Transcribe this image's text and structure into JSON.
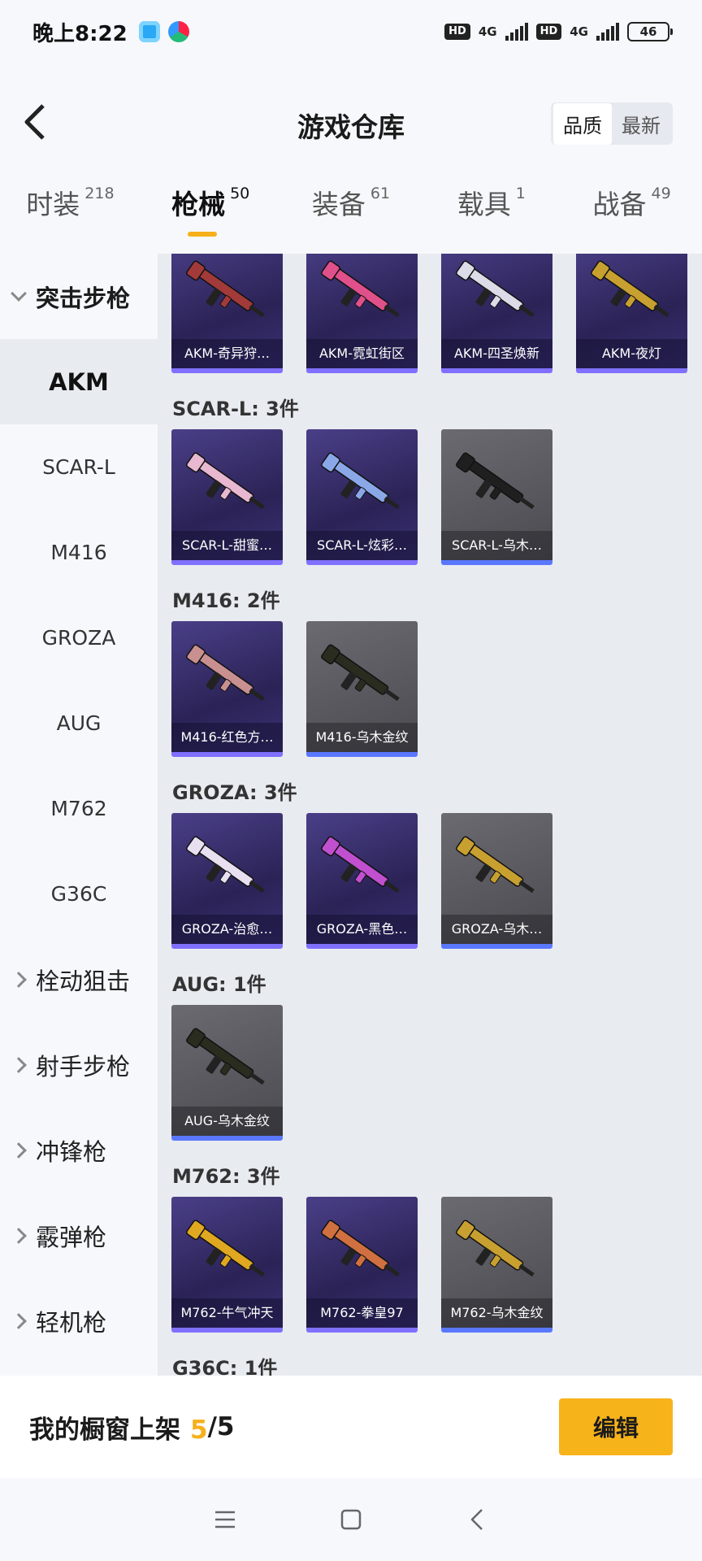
{
  "status_bar": {
    "time": "晚上8:22",
    "network_1": "4G",
    "network_2": "4G",
    "hd": "HD",
    "battery": "46"
  },
  "header": {
    "title": "游戏仓库",
    "sort_options": [
      "品质",
      "最新"
    ],
    "sort_selected": "品质"
  },
  "tabs": [
    {
      "label": "时装",
      "count": "218"
    },
    {
      "label": "枪械",
      "count": "50",
      "active": true
    },
    {
      "label": "装备",
      "count": "61"
    },
    {
      "label": "载具",
      "count": "1"
    },
    {
      "label": "战备",
      "count": "49"
    }
  ],
  "sidebar": {
    "groups": [
      {
        "label": "突击步枪",
        "expanded": true
      },
      {
        "label": "栓动狙击"
      },
      {
        "label": "射手步枪"
      },
      {
        "label": "冲锋枪"
      },
      {
        "label": "霰弹枪"
      },
      {
        "label": "轻机枪"
      }
    ],
    "items": [
      "AKM",
      "SCAR-L",
      "M416",
      "GROZA",
      "AUG",
      "M762",
      "G36C"
    ],
    "selected": "AKM"
  },
  "sections": [
    {
      "title": "",
      "cards": [
        {
          "name": "AKM-奇异狩…",
          "style": "purple",
          "color": "#a23a3a"
        },
        {
          "name": "AKM-霓虹街区",
          "style": "purple",
          "color": "#e0508a"
        },
        {
          "name": "AKM-四圣焕新",
          "style": "purple",
          "color": "#dcdce8"
        },
        {
          "name": "AKM-夜灯",
          "style": "purple",
          "color": "#c8a030"
        }
      ]
    },
    {
      "title": "SCAR-L: 3件",
      "cards": [
        {
          "name": "SCAR-L-甜蜜…",
          "style": "purple",
          "color": "#e8b8d0"
        },
        {
          "name": "SCAR-L-炫彩…",
          "style": "purple",
          "color": "#8aa8e8"
        },
        {
          "name": "SCAR-L-乌木…",
          "style": "gray",
          "color": "#1f1f1f"
        }
      ]
    },
    {
      "title": "M416: 2件",
      "cards": [
        {
          "name": "M416-红色方…",
          "style": "purple",
          "color": "#c89090"
        },
        {
          "name": "M416-乌木金纹",
          "style": "gray",
          "color": "#2a2c20"
        }
      ]
    },
    {
      "title": "GROZA: 3件",
      "cards": [
        {
          "name": "GROZA-治愈…",
          "style": "purple",
          "color": "#e8e0f0"
        },
        {
          "name": "GROZA-黑色…",
          "style": "purple",
          "color": "#c050d0"
        },
        {
          "name": "GROZA-乌木…",
          "style": "gray",
          "color": "#c8a030"
        }
      ]
    },
    {
      "title": "AUG: 1件",
      "cards": [
        {
          "name": "AUG-乌木金纹",
          "style": "gray",
          "color": "#2a2c20"
        }
      ]
    },
    {
      "title": "M762: 3件",
      "cards": [
        {
          "name": "M762-牛气冲天",
          "style": "purple",
          "color": "#e0a820"
        },
        {
          "name": "M762-拳皇97",
          "style": "purple",
          "color": "#d07040"
        },
        {
          "name": "M762-乌木金纹",
          "style": "gray",
          "color": "#c8a030"
        }
      ]
    },
    {
      "title": "G36C: 1件",
      "cards": []
    }
  ],
  "bottom_bar": {
    "label": "我的橱窗上架",
    "used": "5",
    "total": "/5",
    "edit_label": "编辑"
  }
}
